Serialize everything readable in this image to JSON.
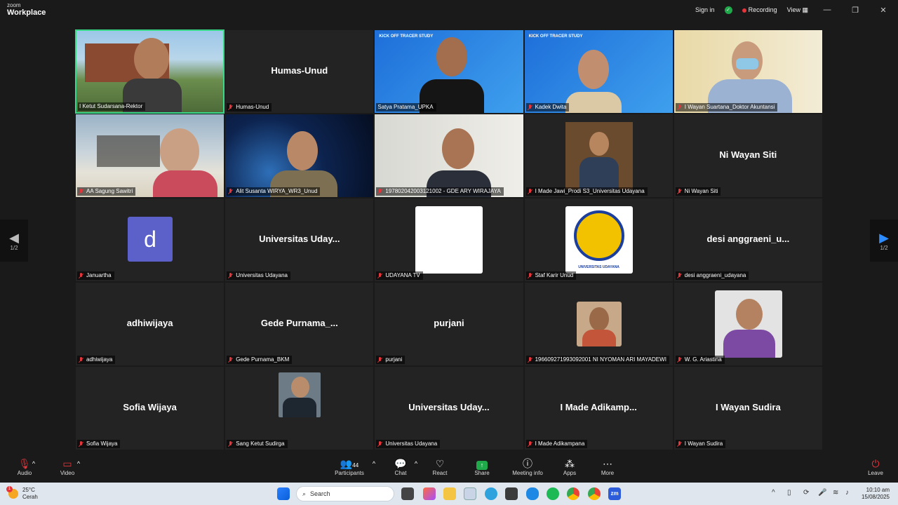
{
  "app": {
    "brand_top": "zoom",
    "brand_bottom": "Workplace"
  },
  "titlebar": {
    "sign_in": "Sign in",
    "recording": "Recording",
    "view": "View"
  },
  "tiles": [
    {
      "name": "I Ketut Sudarsana-Rektor",
      "big": ""
    },
    {
      "name": "Humas-Unud",
      "big": "Humas-Unud"
    },
    {
      "name": "Satya Pratama_UPKA",
      "big": "",
      "banner": "KICK OFF TRACER STUDY"
    },
    {
      "name": "Kadek Dwita",
      "big": "",
      "banner": "KICK OFF TRACER STUDY"
    },
    {
      "name": "I Wayan Suartana_Doktor Akuntansi",
      "big": ""
    },
    {
      "name": "AA Sagung Sawitri",
      "big": ""
    },
    {
      "name": "Alit Susanta WIRYA_WR3_Unud",
      "big": ""
    },
    {
      "name": "197802042003121002 - GDE ARY WIRAJAYA",
      "big": ""
    },
    {
      "name": "I Made Jawi_Prodi S3_Universitas Udayana",
      "big": ""
    },
    {
      "name": "Ni Wayan Siti",
      "big": "Ni Wayan Siti"
    },
    {
      "name": "Januartha",
      "big": "",
      "avatar_letter": "d"
    },
    {
      "name": "Universitas Udayana",
      "big": "Universitas Uday..."
    },
    {
      "name": "UDAYANA TV",
      "big": ""
    },
    {
      "name": "Staf Karir Unud",
      "big": "",
      "logo_text": "UNIVERSITAS UDAYANA"
    },
    {
      "name": "desi anggraeni_udayana",
      "big": "desi anggraeni_u..."
    },
    {
      "name": "adhiwijaya",
      "big": "adhiwijaya"
    },
    {
      "name": "Gede Purnama_BKM",
      "big": "Gede Purnama_..."
    },
    {
      "name": "purjani",
      "big": "purjani"
    },
    {
      "name": "196609271993092001 NI NYOMAN ARI MAYADEWI",
      "big": ""
    },
    {
      "name": "W. G. Ariastina",
      "big": ""
    },
    {
      "name": "Sofia Wijaya",
      "big": "Sofia Wijaya"
    },
    {
      "name": "Sang Ketut Sudirga",
      "big": ""
    },
    {
      "name": "Universitas Udayana",
      "big": "Universitas Uday..."
    },
    {
      "name": "I Made Adikampana",
      "big": "I Made Adikamp..."
    },
    {
      "name": "I Wayan Sudira",
      "big": "I Wayan Sudira"
    }
  ],
  "pager": {
    "left": "1/2",
    "right": "1/2"
  },
  "toolbar": {
    "audio": "Audio",
    "video": "Video",
    "participants": "Participants",
    "participants_count": "44",
    "chat": "Chat",
    "react": "React",
    "share": "Share",
    "meeting_info": "Meeting info",
    "apps": "Apps",
    "more": "More",
    "leave": "Leave"
  },
  "taskbar": {
    "temp": "25°C",
    "cond": "Cerah",
    "badge": "1",
    "search": "Search",
    "time": "10:10 am",
    "date": "15/08/2025"
  }
}
